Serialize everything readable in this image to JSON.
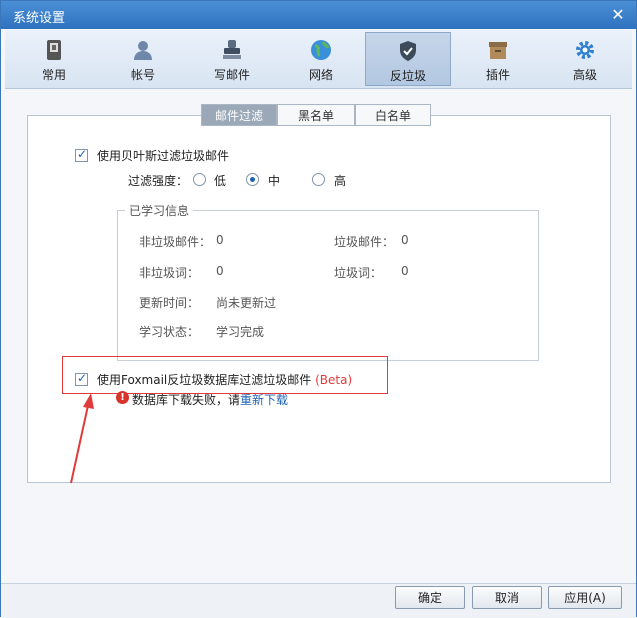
{
  "window": {
    "title": "系统设置"
  },
  "toolbar": {
    "items": [
      {
        "label": "常用",
        "icon": "switch-icon"
      },
      {
        "label": "帐号",
        "icon": "user-icon"
      },
      {
        "label": "写邮件",
        "icon": "stamp-icon"
      },
      {
        "label": "网络",
        "icon": "globe-icon"
      },
      {
        "label": "反垃圾",
        "icon": "shield-icon",
        "active": true
      },
      {
        "label": "插件",
        "icon": "box-icon"
      },
      {
        "label": "高级",
        "icon": "gear-icon"
      }
    ]
  },
  "subtabs": [
    {
      "label": "邮件过滤",
      "active": true
    },
    {
      "label": "黑名单"
    },
    {
      "label": "白名单"
    }
  ],
  "bayes": {
    "checkbox_label": "使用贝叶斯过滤垃圾邮件",
    "checked": true,
    "strength_label": "过滤强度：",
    "options": [
      "低",
      "中",
      "高"
    ],
    "selected": "中"
  },
  "learned": {
    "title": "已学习信息",
    "non_spam_mail_label": "非垃圾邮件：",
    "non_spam_mail_value": "0",
    "spam_mail_label": "垃圾邮件：",
    "spam_mail_value": "0",
    "non_spam_words_label": "非垃圾词：",
    "non_spam_words_value": "0",
    "spam_words_label": "垃圾词：",
    "spam_words_value": "0",
    "update_time_label": "更新时间：",
    "update_time_value": "尚未更新过",
    "learn_status_label": "学习状态：",
    "learn_status_value": "学习完成"
  },
  "foxmail_db": {
    "checkbox_label": "使用Foxmail反垃圾数据库过滤垃圾邮件",
    "beta": "(Beta)",
    "checked": true,
    "error_text": "数据库下载失败，请",
    "retry_link": "重新下载"
  },
  "footer": {
    "ok": "确定",
    "cancel": "取消",
    "apply": "应用(A)"
  },
  "colors": {
    "accent": "#2f72c0",
    "highlight_box": "#e03b3b",
    "link": "#1f63b4"
  }
}
